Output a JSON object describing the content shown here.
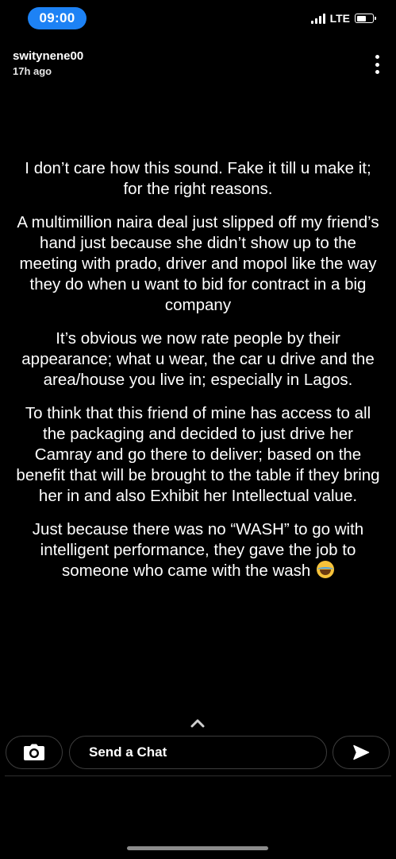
{
  "status_bar": {
    "time": "09:00",
    "network": "LTE",
    "signal_bars": 4,
    "battery_level": 0.6
  },
  "story": {
    "username": "switynene00",
    "posted": "17h ago",
    "paragraphs": [
      "I don’t care how this sound. Fake it till u make it; for the right reasons.",
      "A multimillion naira deal just slipped off my friend’s hand  just because she didn’t show up to the meeting with prado, driver and mopol like the way they do when u want to bid for contract in a big company",
      "It’s obvious we now rate people by their appearance; what u wear, the car u drive and the area/house you live in; especially in Lagos.",
      "To think that this friend of mine has access to all the packaging and decided to just drive her Camray and  go there to deliver; based on the benefit that will be brought to the table if they bring her in and also Exhibit her Intellectual value.",
      "Just because there was no “WASH” to go with intelligent performance, they gave the job to someone who came with the wash"
    ],
    "closing_emoji": "face-with-tears-of-joy"
  },
  "icons": {
    "menu": "more-vertical-icon",
    "swipe": "chevron-up-icon",
    "camera": "camera-icon",
    "send": "send-arrow-icon"
  },
  "chat_bar": {
    "placeholder": "Send a Chat"
  },
  "colors": {
    "background": "#000000",
    "time_pill": "#1d82f5",
    "text": "#ffffff"
  }
}
